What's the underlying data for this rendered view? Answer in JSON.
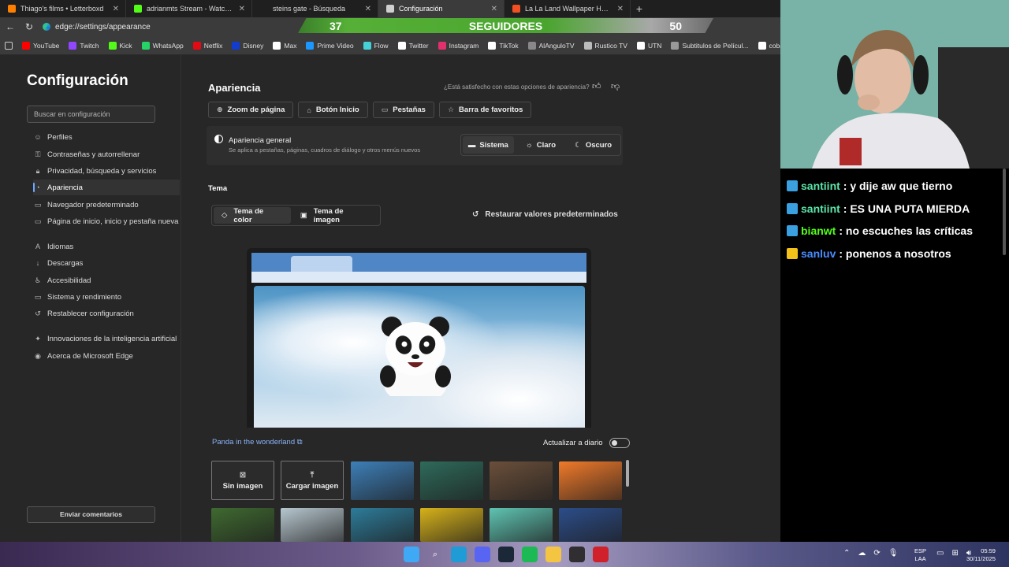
{
  "tabs": [
    {
      "label": "Thiago's films • Letterboxd",
      "color": "#ff8000"
    },
    {
      "label": "adrianmts Stream - Watch Live o",
      "color": "#53fc18"
    },
    {
      "label": "steins gate - Búsqueda",
      "color": "#1f1f1f"
    },
    {
      "label": "Configuración",
      "color": "#cfcfcf"
    },
    {
      "label": "La La Land Wallpaper HD HomeP",
      "color": "#f25022"
    }
  ],
  "address": {
    "url": "edge://settings/appearance"
  },
  "followers": {
    "current": "37",
    "label": "SEGUIDORES",
    "goal": "50"
  },
  "bookmarks": [
    {
      "label": "YouTube",
      "color": "#ff0000"
    },
    {
      "label": "Twitch",
      "color": "#9146ff"
    },
    {
      "label": "Kick",
      "color": "#53fc18"
    },
    {
      "label": "WhatsApp",
      "color": "#25d366"
    },
    {
      "label": "Netflix",
      "color": "#e50914"
    },
    {
      "label": "Disney",
      "color": "#113ccf"
    },
    {
      "label": "Max",
      "color": "#ffffff"
    },
    {
      "label": "Prime Video",
      "color": "#1a98ff"
    },
    {
      "label": "Flow",
      "color": "#44d0d6"
    },
    {
      "label": "Twitter",
      "color": "#ffffff"
    },
    {
      "label": "Instagram",
      "color": "#e1306c"
    },
    {
      "label": "TikTok",
      "color": "#ffffff"
    },
    {
      "label": "AlAnguloTV",
      "color": "#888888"
    },
    {
      "label": "Rustico TV",
      "color": "#bbbbbb"
    },
    {
      "label": "UTN",
      "color": "#ffffff"
    },
    {
      "label": "Subtitulos de Películ...",
      "color": "#999999"
    },
    {
      "label": "cobalt",
      "color": "#ffffff"
    }
  ],
  "sidebar": {
    "title": "Configuración",
    "search_placeholder": "Buscar en configuración",
    "items": [
      {
        "label": "Perfiles",
        "icon": "person-icon",
        "glyph": "☺"
      },
      {
        "label": "Contraseñas y autorrellenar",
        "icon": "key-icon",
        "glyph": "⚿"
      },
      {
        "label": "Privacidad, búsqueda y servicios",
        "icon": "lock-icon",
        "glyph": "🔒︎"
      },
      {
        "label": "Apariencia",
        "icon": "appearance-icon",
        "glyph": "◔"
      },
      {
        "label": "Navegador predeterminado",
        "icon": "browser-icon",
        "glyph": "▭"
      },
      {
        "label": "Página de inicio, inicio y pestaña nueva",
        "icon": "home-icon",
        "glyph": "▭"
      },
      {
        "label": "Idiomas",
        "icon": "language-icon",
        "glyph": "A"
      },
      {
        "label": "Descargas",
        "icon": "download-icon",
        "glyph": "↓"
      },
      {
        "label": "Accesibilidad",
        "icon": "accessibility-icon",
        "glyph": "♿︎"
      },
      {
        "label": "Sistema y rendimiento",
        "icon": "system-icon",
        "glyph": "▭"
      },
      {
        "label": "Restablecer configuración",
        "icon": "reset-icon",
        "glyph": "↺"
      },
      {
        "label": "Innovaciones de la inteligencia artificial",
        "icon": "ai-icon",
        "glyph": "✦"
      },
      {
        "label": "Acerca de Microsoft Edge",
        "icon": "edge-icon",
        "glyph": "◉"
      }
    ],
    "feedback": "Enviar comentarios"
  },
  "main": {
    "title": "Apariencia",
    "satisfaction": "¿Está satisfecho con estas opciones de apariencia?",
    "pills": [
      {
        "label": "Zoom de página",
        "icon": "zoom-icon",
        "glyph": "⊕"
      },
      {
        "label": "Botón Inicio",
        "icon": "home-icon",
        "glyph": "⌂"
      },
      {
        "label": "Pestañas",
        "icon": "tabs-icon",
        "glyph": "▭"
      },
      {
        "label": "Barra de favoritos",
        "icon": "favorites-icon",
        "glyph": "☆"
      }
    ],
    "general": {
      "title": "Apariencia general",
      "subtitle": "Se aplica a pestañas, páginas, cuadros de diálogo y otros menús nuevos",
      "modes": [
        {
          "label": "Sistema",
          "glyph": "▬",
          "active": true
        },
        {
          "label": "Claro",
          "glyph": "☼",
          "active": false
        },
        {
          "label": "Oscuro",
          "glyph": "☾",
          "active": false
        }
      ]
    },
    "theme_heading": "Tema",
    "theme_tabs": [
      {
        "label": "Tema de color",
        "glyph": "◇",
        "active": true
      },
      {
        "label": "Tema de imagen",
        "glyph": "▣",
        "active": false
      }
    ],
    "restore": "Restaurar valores predeterminados",
    "theme_name": "Panda in the wonderland",
    "daily_label": "Actualizar a diario",
    "daily_on": false,
    "tile_buttons": [
      {
        "label": "Sin imagen",
        "glyph": "⊠"
      },
      {
        "label": "Cargar imagen",
        "glyph": "⤒"
      }
    ],
    "wallpaper_colors": [
      "#3d7fb8",
      "#2e6a5a",
      "#6a4f3a",
      "#f07a2a",
      "#3f6a30",
      "#b7c7cf",
      "#2d7c9a",
      "#d7b21a",
      "#5fc4b2",
      "#2c4d8a"
    ]
  },
  "chat": [
    {
      "user": "santiint",
      "text": ": y dije aw que tierno",
      "user_color": "#5ce4a8",
      "badge": "#3aa0e0"
    },
    {
      "user": "santiint",
      "text": ": ES UNA PUTA MIERDA",
      "user_color": "#5ce4a8",
      "badge": "#3aa0e0"
    },
    {
      "user": "bianwt",
      "text": ": no escuches las críticas",
      "user_color": "#53fc18",
      "badge": "#3aa0e0"
    },
    {
      "user": "sanluv",
      "text": ": ponenos a nosotros",
      "user_color": "#4a8cff",
      "badge": "#f2c21a"
    }
  ],
  "taskbar": {
    "lang1": "ESP",
    "lang2": "LAA",
    "time": "05:59",
    "date": "30/11/2025",
    "apps": [
      {
        "name": "windows-icon",
        "color": "#3fa9f5"
      },
      {
        "name": "search-icon",
        "color": "transparent"
      },
      {
        "name": "edge-icon",
        "color": "#1f9bd6"
      },
      {
        "name": "discord-icon",
        "color": "#5865f2"
      },
      {
        "name": "steam-icon",
        "color": "#1b2838"
      },
      {
        "name": "spotify-icon",
        "color": "#1db954"
      },
      {
        "name": "explorer-icon",
        "color": "#f4c542"
      },
      {
        "name": "obs-icon",
        "color": "#302e31"
      },
      {
        "name": "media-icon",
        "color": "#d0202b"
      }
    ]
  }
}
